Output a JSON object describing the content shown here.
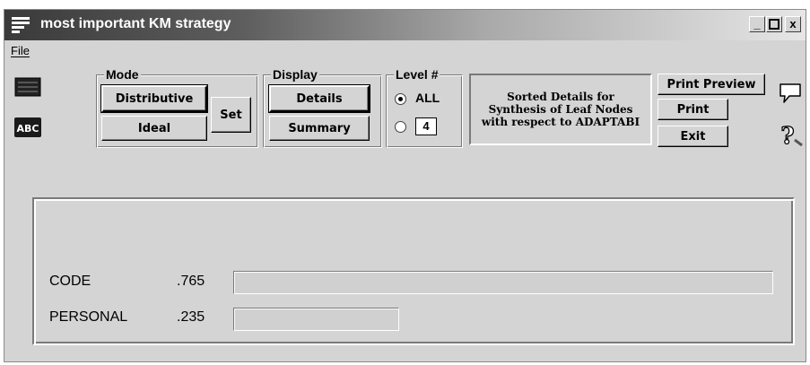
{
  "window": {
    "title": "most important KM strategy"
  },
  "title_buttons": {
    "minimize": "_",
    "maximize": "□",
    "close": "x"
  },
  "menu": {
    "items": [
      "File"
    ]
  },
  "toolbar": {
    "left_icons": [
      "keyboard-icon",
      "abc-text-icon"
    ]
  },
  "mode_group": {
    "label": "Mode",
    "distributive": "Distributive",
    "ideal": "Ideal",
    "set": "Set"
  },
  "display_group": {
    "label": "Display",
    "details": "Details",
    "summary": "Summary"
  },
  "level_group": {
    "label": "Level #",
    "all_label": "ALL",
    "selected": "ALL",
    "level_value": "4"
  },
  "info": {
    "text": "Sorted Details for Synthesis of Leaf Nodes with respect to ADAPTABI"
  },
  "actions": {
    "print_preview": "Print Preview",
    "print": "Print",
    "exit": "Exit"
  },
  "right_icons": [
    "speech-bubble-icon",
    "help-question-icon"
  ],
  "results": [
    {
      "label": "CODE",
      "value": ".765",
      "fraction": 0.765
    },
    {
      "label": "PERSONAL",
      "value": ".235",
      "fraction": 0.235
    }
  ],
  "colors": {
    "window_bg": "#d4d4d4",
    "titlebar_dark": "#3a3a3a"
  }
}
